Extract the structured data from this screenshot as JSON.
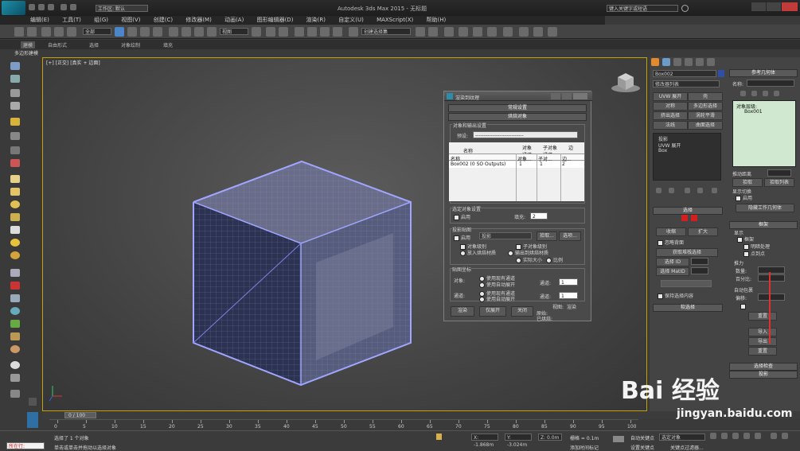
{
  "app": {
    "title": "Autodesk 3ds Max 2015 - 无标题",
    "workspace_label": "工作区: 默认",
    "search_placeholder": "键入关键字或短语"
  },
  "menu": [
    "编辑(E)",
    "工具(T)",
    "组(G)",
    "视图(V)",
    "创建(C)",
    "修改器(M)",
    "动画(A)",
    "图形编辑器(D)",
    "渲染(R)",
    "自定义(U)",
    "MAXScript(X)",
    "帮助(H)"
  ],
  "toolbar": {
    "selection_filter": "全部",
    "ref_coord": "视图",
    "named_sel": "创建选择集"
  },
  "ribbon": {
    "tabs": [
      "建模",
      "自由形式",
      "选择",
      "对象绘制",
      "填充"
    ],
    "sub": "多边形建模"
  },
  "viewport": {
    "label": "[+] [正交] [真实 + 边面]"
  },
  "dialog": {
    "title": "渲染到纹理",
    "rollout_general": "常规设置",
    "rollout_bake": "烘焙对象",
    "group_object_output": "对象和输出设置",
    "preset_label": "预设:",
    "preset_value": "----------------------------",
    "table_headers": [
      "名称",
      "对象通道",
      "子对象通道",
      "边"
    ],
    "table_subheader_name": "名称",
    "table_subheaders": [
      "对象...",
      "子对...",
      "边..."
    ],
    "table_row": {
      "name": "Box002 (0 SO Outputs)",
      "obj": "1",
      "sub": "1",
      "edge": "2"
    },
    "selected_settings": "选定对象设置",
    "enable": "启用",
    "padding_label": "填充:",
    "padding_value": "2",
    "projection": "投影贴图",
    "projection_enable": "启用",
    "projection_type": "投影",
    "pick": "拾取...",
    "options": "选项...",
    "object_level": "对象级别",
    "subobject_level": "子对象级别",
    "put_to_bake": "放入烘焙材质",
    "put_to_output": "输出到烘焙材质",
    "full_size": "实际大小",
    "proportional": "比例",
    "mapping_coords": "贴图坐标",
    "object_label": "对象:",
    "use_existing": "使用现有通道",
    "use_auto": "使用自动展开",
    "channel_label": "通道:",
    "channel_value": "1",
    "subobj_label": "通道:",
    "render_btn": "渲染",
    "unwrap_btn": "仅展开",
    "close_btn": "关闭",
    "view_label": "视图:",
    "render_label": "渲染",
    "orig_label": "原始:",
    "baked_label": "已烘焙:"
  },
  "command_panel": {
    "object_name": "Box002",
    "modifier_list": "修改器列表",
    "buttons_left": [
      "UVW 展开",
      "对称",
      "挤出选择",
      "法线"
    ],
    "buttons_right": [
      "壳",
      "多边形选择",
      "涡轮平滑",
      "曲面选择"
    ],
    "stack": [
      "投影",
      "UVW 展开",
      "Box"
    ],
    "selection_title": "选择",
    "shrink": "收缩",
    "grow": "扩大",
    "ignore_back": "忽略背面",
    "remove_edge": "获取堆栈选择",
    "select_by_id": "选择 ID",
    "select_by_smooth": "选择 MatID",
    "use_selection": "保持选择内容",
    "soft_selection": "软选择"
  },
  "ref_panel": {
    "title": "参考几何体",
    "name_label": "名称:",
    "object_level": "对象层级:",
    "item": "Box001",
    "add_btn": "拾取",
    "pick_list_btn": "拾取列表",
    "push_label": "推动距离",
    "show_switch": "显示切换",
    "enable": "启用",
    "show_settings": "隐藏工作几何体",
    "cage_title": "框架",
    "display": "显示",
    "cage": "框架",
    "shaded": "明暗处理",
    "points": "点到点",
    "push_title": "推力",
    "amount": "数量:",
    "percent": "百分比:",
    "auto_wrap": "自动包裹",
    "offset": "偏移:",
    "reset": "重置",
    "export": "导出",
    "import": "导入",
    "reset_btn": "重置",
    "sel_check": "选择检查",
    "projection": "投影"
  },
  "timeline": {
    "frame": "0 / 100",
    "ticks": [
      "0",
      "5",
      "10",
      "15",
      "20",
      "25",
      "30",
      "35",
      "40",
      "45",
      "50",
      "55",
      "60",
      "65",
      "70",
      "75",
      "80",
      "85",
      "90",
      "95",
      "100"
    ]
  },
  "status": {
    "selected": "选择了 1 个对象",
    "hint": "单击或单击并拖动以选择对象",
    "script": "所在行:",
    "x": "X: -1.868m",
    "y": "Y: -3.024m",
    "z": "Z: 0.0m",
    "grid": "栅格 = 0.1m",
    "autokey": "自动关键点",
    "set_key": "设置关键点",
    "sel_obj": "选定对象",
    "keyfilter": "关键点过滤器...",
    "add_time_tag": "添加时间标记"
  },
  "watermark": {
    "brand": "Bai 经验",
    "url": "jingyan.baidu.com"
  },
  "colors": {
    "accent": "#c8a000",
    "cube_edge": "#9aa0ff",
    "panel_bg": "#444444",
    "selection_red": "#d22020"
  }
}
